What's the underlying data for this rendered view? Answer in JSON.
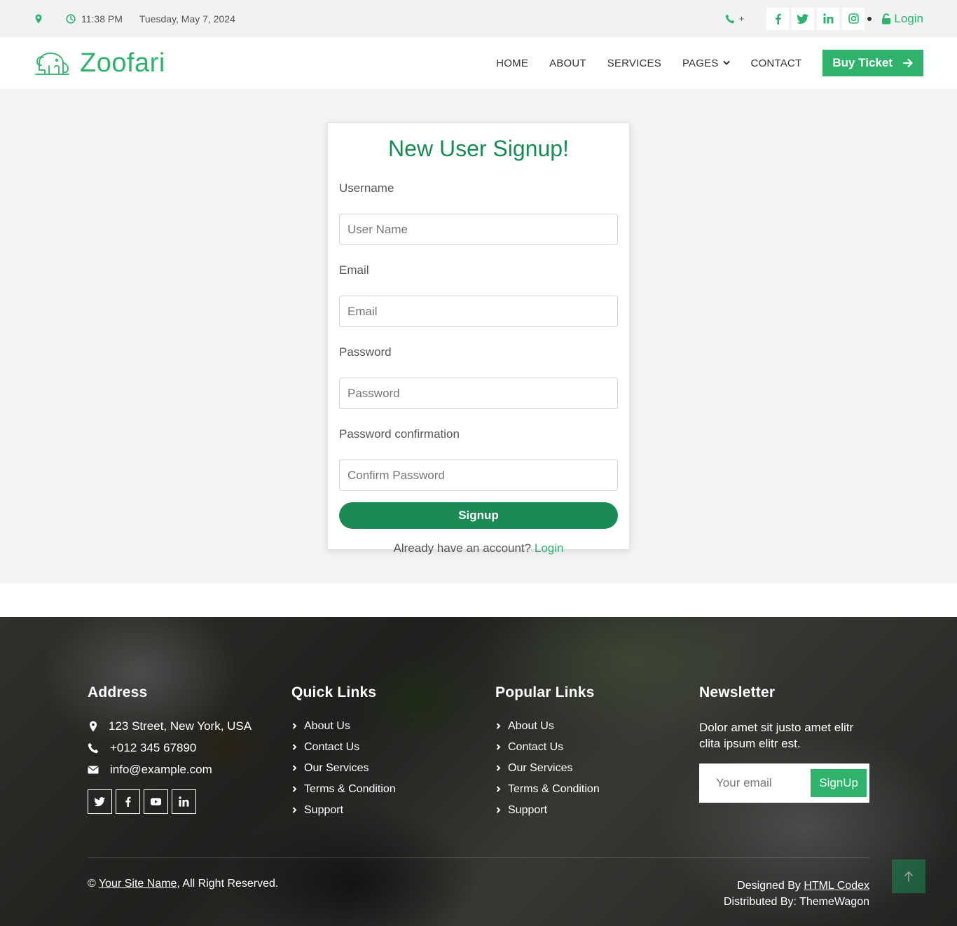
{
  "topbar": {
    "time": "11:38 PM",
    "date": "Tuesday, May 7, 2024",
    "phone": "+",
    "login": "Login"
  },
  "navbar": {
    "brand": "Zoofari",
    "links": [
      "HOME",
      "ABOUT",
      "SERVICES",
      "PAGES",
      "CONTACT"
    ],
    "buy_ticket": "Buy Ticket"
  },
  "signup": {
    "title": "New User Signup!",
    "username_label": "Username",
    "username_placeholder": "User Name",
    "email_label": "Email",
    "email_placeholder": "Email",
    "password_label": "Password",
    "password_placeholder": "Password",
    "confirm_label": "Password confirmation",
    "confirm_placeholder": "Confirm Password",
    "submit": "Signup",
    "already_text": "Already have an account?",
    "login_link": "Login"
  },
  "footer": {
    "address_title": "Address",
    "address": "123 Street, New York, USA",
    "phone": "+012 345 67890",
    "email": "info@example.com",
    "quick_title": "Quick Links",
    "quick_links": [
      "About Us",
      "Contact Us",
      "Our Services",
      "Terms & Condition",
      "Support"
    ],
    "popular_title": "Popular Links",
    "popular_links": [
      "About Us",
      "Contact Us",
      "Our Services",
      "Terms & Condition",
      "Support"
    ],
    "newsletter_title": "Newsletter",
    "newsletter_text": "Dolor amet sit justo amet elitr clita ipsum elitr est.",
    "newsletter_placeholder": "Your email",
    "newsletter_button": "SignUp",
    "copyright_prefix": "©",
    "site_name": "Your Site Name",
    "copyright_suffix": ", All Right Reserved.",
    "designed_by": "Designed By",
    "designer": "HTML Codex",
    "distributed_by": "Distributed By: ThemeWagon"
  },
  "colors": {
    "primary": "#2fb36c",
    "primary_dark": "#1b8a55"
  }
}
